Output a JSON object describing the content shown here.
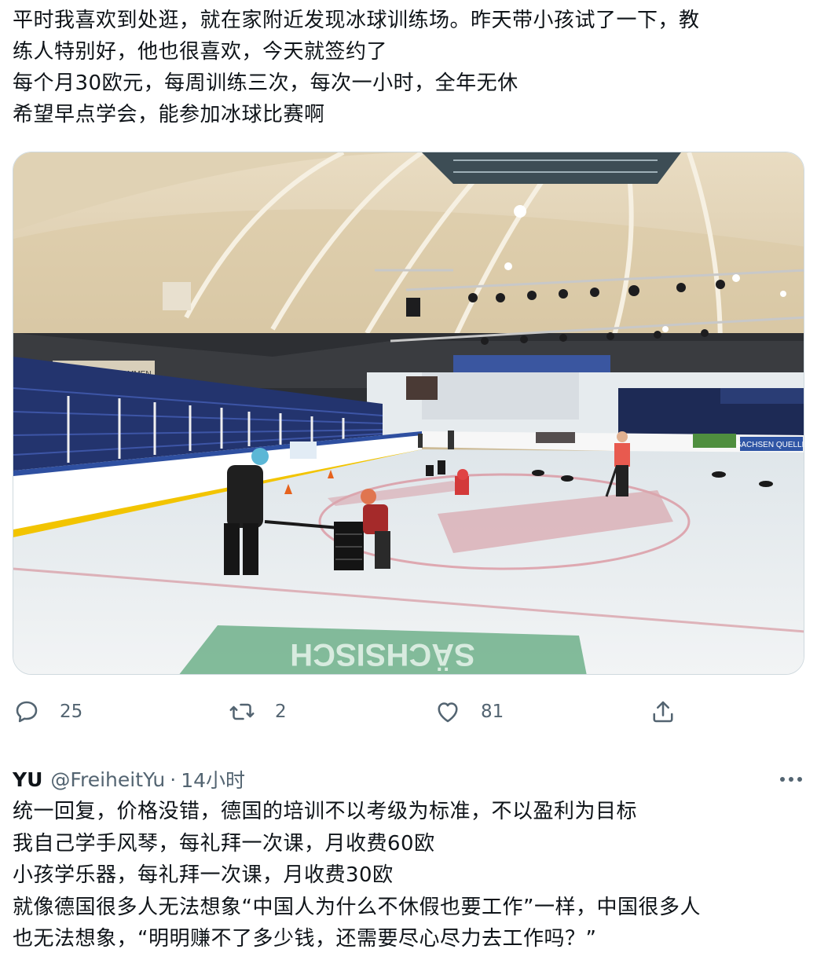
{
  "tweet": {
    "lines": [
      "平时我喜欢到处逛，就在家附近发现冰球训练场。昨天带小孩试了一下，教",
      "练人特别好，他也很喜欢，今天就签约了",
      "每个月30欧元，每周训练三次，每次一小时，全年无休",
      "希望早点学会，能参加冰球比赛啊"
    ]
  },
  "actions": {
    "reply_count": "25",
    "retweet_count": "2",
    "like_count": "81",
    "icons": [
      "reply-icon",
      "retweet-icon",
      "like-icon",
      "share-icon"
    ]
  },
  "reply": {
    "name": "YU",
    "handle": "@FreiheitYu",
    "separator": "·",
    "time": "14小时",
    "lines": [
      "统一回复，价格没错，德国的培训不以考级为标准，不以盈利为目标",
      "我自己学手风琴，每礼拜一次课，月收费60欧",
      "小孩学乐器，每礼拜一次课，月收费30欧",
      "就像德国很多人无法想象“中国人为什么不休假也要工作”一样，中国很多人",
      "也无法想象，“明明赚不了多少钱，还需要尽心尽力去工作吗？”"
    ]
  },
  "photo": {
    "description_icon": "ice-rink-photo",
    "banner_left": "HERZLICH WILLKOMMEN",
    "banner_right": "SACHSEN QUELLE",
    "ice_logo": "SÄCHSISCH"
  },
  "colors": {
    "text": "#0f1419",
    "secondary": "#536471",
    "border": "#cfd9de"
  }
}
